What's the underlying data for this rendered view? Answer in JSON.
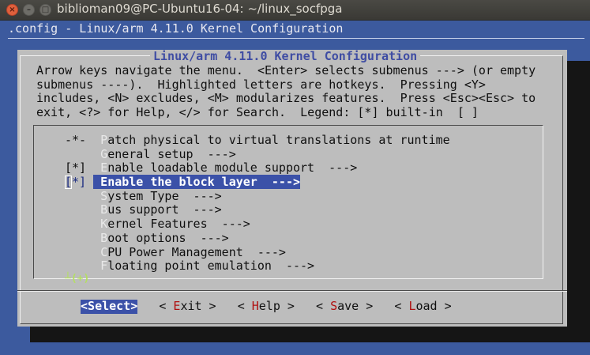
{
  "window": {
    "title": "biblioman09@PC-Ubuntu16-04: ~/linux_socfpga",
    "close_glyph": "×",
    "minimize_glyph": "–",
    "maximize_glyph": "□"
  },
  "header": {
    "config_line": ".config - Linux/arm 4.11.0 Kernel Configuration"
  },
  "dialog": {
    "title": "Linux/arm 4.11.0 Kernel Configuration",
    "help_lines": [
      "Arrow keys navigate the menu.  <Enter> selects submenus ---> (or empty",
      "submenus ----).  Highlighted letters are hotkeys.  Pressing <Y>",
      "includes, <N> excludes, <M> modularizes features.  Press <Esc><Esc> to",
      "exit, <?> for Help, </> for Search.  Legend: [*] built-in  [ ]"
    ],
    "menu_items": [
      {
        "mark": "-*-",
        "hotkey": "P",
        "rest": "atch physical to virtual translations at runtime",
        "suffix": ""
      },
      {
        "mark": "   ",
        "hotkey": "G",
        "rest": "eneral setup",
        "suffix": "  --->"
      },
      {
        "mark": "[*]",
        "hotkey": "E",
        "rest": "nable loadable module support",
        "suffix": "  --->"
      },
      {
        "mark": "[*]",
        "hotkey": "E",
        "rest": "nable the block layer",
        "suffix": "  --->"
      },
      {
        "mark": "   ",
        "hotkey": "S",
        "rest": "ystem Type",
        "suffix": "  --->"
      },
      {
        "mark": "   ",
        "hotkey": "B",
        "rest": "us support",
        "suffix": "  --->"
      },
      {
        "mark": "   ",
        "hotkey": "K",
        "rest": "ernel Features",
        "suffix": "  --->"
      },
      {
        "mark": "   ",
        "hotkey": "B",
        "rest": "oot options",
        "suffix": "  --->"
      },
      {
        "mark": "   ",
        "hotkey": "C",
        "rest": "PU Power Management",
        "suffix": "  --->"
      },
      {
        "mark": "   ",
        "hotkey": "F",
        "rest": "loating point emulation",
        "suffix": "  --->"
      }
    ],
    "selected_index": 3,
    "more_indicator": "┴(+)",
    "buttons": {
      "select": {
        "pre": "<",
        "hotkey": "S",
        "rest": "elect>"
      },
      "exit": {
        "pre": "< ",
        "hotkey": "E",
        "rest": "xit >"
      },
      "help": {
        "pre": "< ",
        "hotkey": "H",
        "rest": "elp >"
      },
      "save": {
        "pre": "< ",
        "hotkey": "S",
        "rest": "ave >"
      },
      "load": {
        "pre": "< ",
        "hotkey": "L",
        "rest": "oad >"
      }
    }
  },
  "colors": {
    "terminal_bg": "#3c5a9e",
    "dialog_bg": "#bdbdbd",
    "selection_bg": "#3b51a8",
    "hotkey_button": "#b01010",
    "title_text": "#3f4da3"
  }
}
